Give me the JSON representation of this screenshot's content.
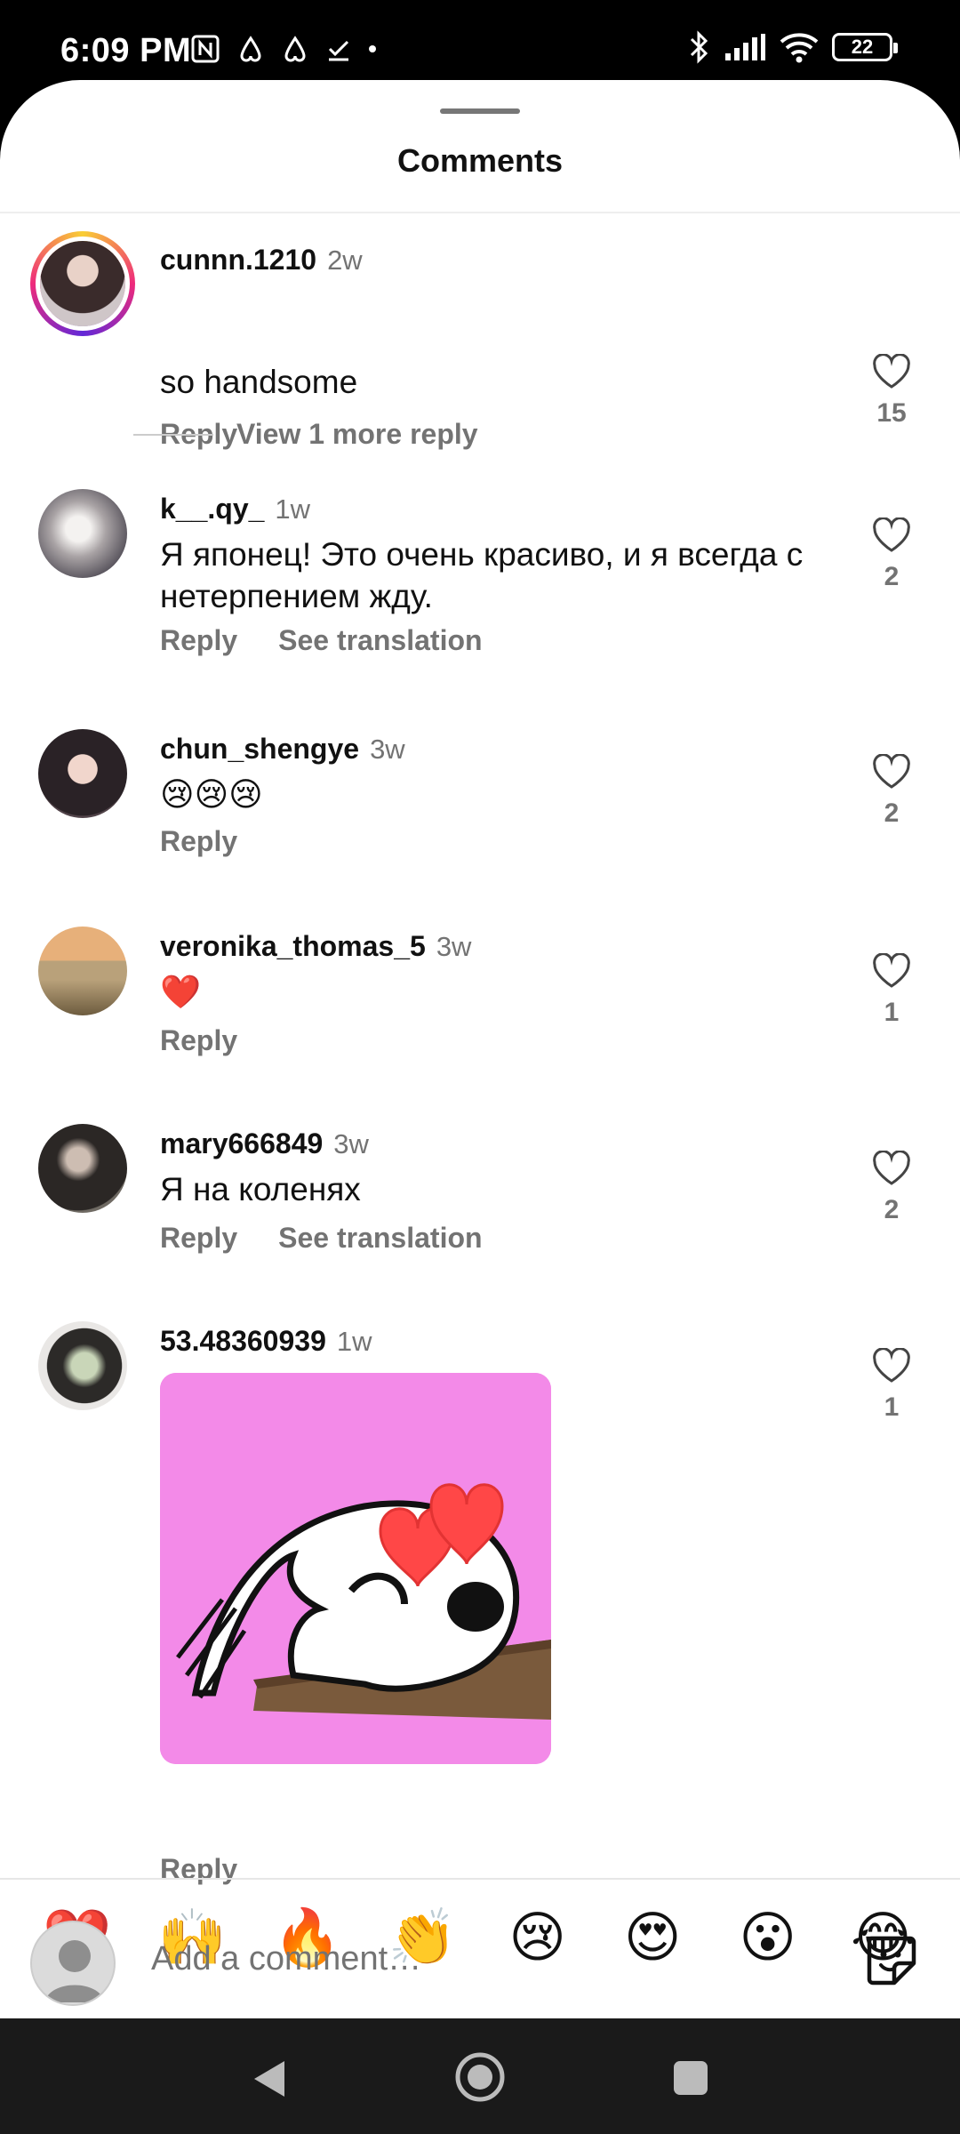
{
  "status_bar": {
    "time": "6:09 PM",
    "battery": "22"
  },
  "sheet": {
    "title": "Comments"
  },
  "comments": [
    {
      "username": "cunnn.1210",
      "time": "2w",
      "text": "so handsome",
      "actions": [
        "Reply"
      ],
      "likes": "15",
      "more_replies": "View 1 more reply"
    },
    {
      "username": "k__.qy_",
      "time": "1w",
      "text": "Я японец! Это очень красиво, и я всегда с нетерпением жду.",
      "actions": [
        "Reply",
        "See translation"
      ],
      "likes": "2"
    },
    {
      "username": "chun_shengye",
      "time": "3w",
      "text": "😢😢😢",
      "actions": [
        "Reply"
      ],
      "likes": "2"
    },
    {
      "username": "veronika_thomas_5",
      "time": "3w",
      "text": "❤️",
      "actions": [
        "Reply"
      ],
      "likes": "1"
    },
    {
      "username": "mary666849",
      "time": "3w",
      "text": "Я на коленях",
      "actions": [
        "Reply",
        "See translation"
      ],
      "likes": "2"
    },
    {
      "username": "53.48360939",
      "time": "1w",
      "text": "",
      "actions": [
        "Reply"
      ],
      "likes": "1"
    }
  ],
  "quick_reactions": [
    "❤️",
    "🙌",
    "🔥",
    "👏",
    "😢",
    "😍",
    "😮",
    "😂"
  ],
  "composer": {
    "placeholder": "Add a comment…"
  },
  "icons": {
    "like": "heart-outline-icon",
    "sticker": "sticker-icon",
    "nav_back": "back-triangle-icon",
    "nav_home": "home-circle-icon",
    "nav_recents": "recents-square-icon"
  }
}
